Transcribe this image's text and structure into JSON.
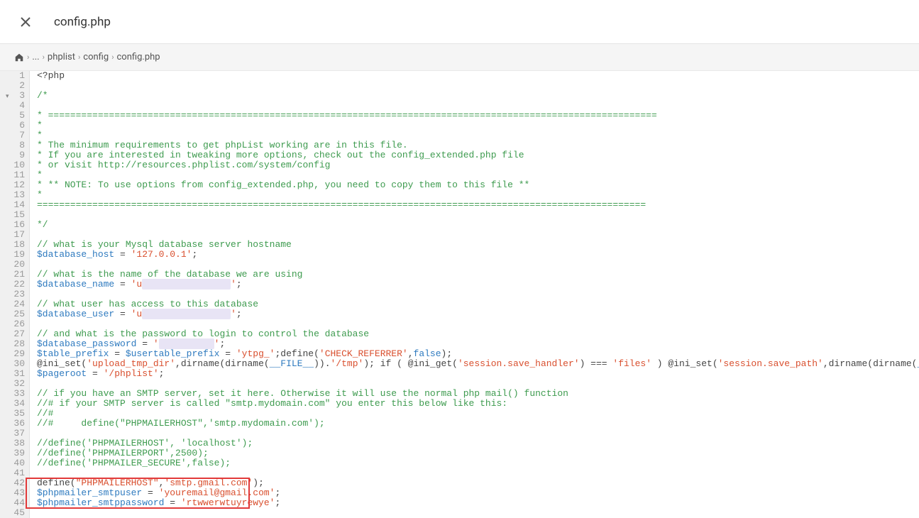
{
  "header": {
    "title": "config.php"
  },
  "breadcrumb": {
    "ellipsis": "...",
    "items": [
      "phplist",
      "config",
      "config.php"
    ]
  },
  "code": {
    "startLine": 1,
    "foldLines": [
      3
    ],
    "lines": [
      {
        "n": 1,
        "segs": [
          [
            "<?php",
            "default"
          ]
        ]
      },
      {
        "n": 2,
        "segs": [
          [
            "",
            "default"
          ]
        ]
      },
      {
        "n": 3,
        "segs": [
          [
            "/*",
            "comment"
          ]
        ]
      },
      {
        "n": 4,
        "segs": [
          [
            "",
            "default"
          ]
        ]
      },
      {
        "n": 5,
        "segs": [
          [
            "* ==============================================================================================================",
            "comment"
          ]
        ]
      },
      {
        "n": 6,
        "segs": [
          [
            "*",
            "comment"
          ]
        ]
      },
      {
        "n": 7,
        "segs": [
          [
            "*",
            "comment"
          ]
        ]
      },
      {
        "n": 8,
        "segs": [
          [
            "* The minimum requirements to get phpList working are in this file.",
            "comment"
          ]
        ]
      },
      {
        "n": 9,
        "segs": [
          [
            "* If you are interested in tweaking more options, check out the config_extended.php file",
            "comment"
          ]
        ]
      },
      {
        "n": 10,
        "segs": [
          [
            "* or visit http://resources.phplist.com/system/config",
            "comment"
          ]
        ]
      },
      {
        "n": 11,
        "segs": [
          [
            "*",
            "comment"
          ]
        ]
      },
      {
        "n": 12,
        "segs": [
          [
            "* ** NOTE: To use options from config_extended.php, you need to copy them to this file **",
            "comment"
          ]
        ]
      },
      {
        "n": 13,
        "segs": [
          [
            "*",
            "comment"
          ]
        ]
      },
      {
        "n": 14,
        "segs": [
          [
            "==============================================================================================================",
            "comment"
          ]
        ]
      },
      {
        "n": 15,
        "segs": [
          [
            "",
            "default"
          ]
        ]
      },
      {
        "n": 16,
        "segs": [
          [
            "*/",
            "comment"
          ]
        ]
      },
      {
        "n": 17,
        "segs": [
          [
            "",
            "default"
          ]
        ]
      },
      {
        "n": 18,
        "segs": [
          [
            "// what is your Mysql database server hostname",
            "comment"
          ]
        ]
      },
      {
        "n": 19,
        "segs": [
          [
            "$database_host",
            "var"
          ],
          [
            " = ",
            "default"
          ],
          [
            "'127.0.0.1'",
            "string"
          ],
          [
            ";",
            "default"
          ]
        ]
      },
      {
        "n": 20,
        "segs": [
          [
            "",
            "default"
          ]
        ]
      },
      {
        "n": 21,
        "segs": [
          [
            "// what is the name of the database we are using",
            "comment"
          ]
        ]
      },
      {
        "n": 22,
        "segs": [
          [
            "$database_name",
            "var"
          ],
          [
            " = ",
            "default"
          ],
          [
            "'u",
            "string"
          ],
          [
            "                ",
            "redacted"
          ],
          [
            "'",
            "string"
          ],
          [
            ";",
            "default"
          ]
        ]
      },
      {
        "n": 23,
        "segs": [
          [
            "",
            "default"
          ]
        ]
      },
      {
        "n": 24,
        "segs": [
          [
            "// what user has access to this database",
            "comment"
          ]
        ]
      },
      {
        "n": 25,
        "segs": [
          [
            "$database_user",
            "var"
          ],
          [
            " = ",
            "default"
          ],
          [
            "'u",
            "string"
          ],
          [
            "                ",
            "redacted"
          ],
          [
            "'",
            "string"
          ],
          [
            ";",
            "default"
          ]
        ]
      },
      {
        "n": 26,
        "segs": [
          [
            "",
            "default"
          ]
        ]
      },
      {
        "n": 27,
        "segs": [
          [
            "// and what is the password to login to control the database",
            "comment"
          ]
        ]
      },
      {
        "n": 28,
        "segs": [
          [
            "$database_password",
            "var"
          ],
          [
            " = ",
            "default"
          ],
          [
            "'",
            "string"
          ],
          [
            "          ",
            "redacted"
          ],
          [
            "'",
            "string"
          ],
          [
            ";",
            "default"
          ]
        ]
      },
      {
        "n": 29,
        "segs": [
          [
            "$table_prefix",
            "var"
          ],
          [
            " = ",
            "default"
          ],
          [
            "$usertable_prefix",
            "var"
          ],
          [
            " = ",
            "default"
          ],
          [
            "'ytpg_'",
            "string"
          ],
          [
            ";define(",
            "default"
          ],
          [
            "'CHECK_REFERRER'",
            "string"
          ],
          [
            ",",
            "default"
          ],
          [
            "false",
            "const"
          ],
          [
            ");",
            "default"
          ]
        ]
      },
      {
        "n": 30,
        "segs": [
          [
            "@ini_set(",
            "default"
          ],
          [
            "'upload_tmp_dir'",
            "string"
          ],
          [
            ",dirname(dirname(",
            "default"
          ],
          [
            "__FILE__",
            "const"
          ],
          [
            ")).",
            "default"
          ],
          [
            "'/tmp'",
            "string"
          ],
          [
            "); if ( @ini_get(",
            "default"
          ],
          [
            "'session.save_handler'",
            "string"
          ],
          [
            ") === ",
            "default"
          ],
          [
            "'files'",
            "string"
          ],
          [
            " ) @ini_set(",
            "default"
          ],
          [
            "'session.save_path'",
            "string"
          ],
          [
            ",dirname(dirname(",
            "default"
          ],
          [
            "__FILE__",
            "const"
          ],
          [
            ")).",
            "default"
          ],
          [
            "'/tmp'",
            "string"
          ],
          [
            ");",
            "default"
          ]
        ]
      },
      {
        "n": 31,
        "segs": [
          [
            "$pageroot",
            "var"
          ],
          [
            " = ",
            "default"
          ],
          [
            "'/phplist'",
            "string"
          ],
          [
            ";",
            "default"
          ]
        ]
      },
      {
        "n": 32,
        "segs": [
          [
            "",
            "default"
          ]
        ]
      },
      {
        "n": 33,
        "segs": [
          [
            "// if you have an SMTP server, set it here. Otherwise it will use the normal php mail() function",
            "comment"
          ]
        ]
      },
      {
        "n": 34,
        "segs": [
          [
            "//# if your SMTP server is called \"smtp.mydomain.com\" you enter this below like this:",
            "comment"
          ]
        ]
      },
      {
        "n": 35,
        "segs": [
          [
            "//#",
            "comment"
          ]
        ]
      },
      {
        "n": 36,
        "segs": [
          [
            "//#     define(\"PHPMAILERHOST\",'smtp.mydomain.com');",
            "comment"
          ]
        ]
      },
      {
        "n": 37,
        "segs": [
          [
            "",
            "default"
          ]
        ]
      },
      {
        "n": 38,
        "segs": [
          [
            "//define('PHPMAILERHOST', 'localhost');",
            "comment"
          ]
        ]
      },
      {
        "n": 39,
        "segs": [
          [
            "//define('PHPMAILERPORT',2500);",
            "comment"
          ]
        ]
      },
      {
        "n": 40,
        "segs": [
          [
            "//define('PHPMAILER_SECURE',false);",
            "comment"
          ]
        ]
      },
      {
        "n": 41,
        "segs": [
          [
            "",
            "default"
          ]
        ]
      },
      {
        "n": 42,
        "segs": [
          [
            "define(",
            "default"
          ],
          [
            "\"PHPMAILERHOST\"",
            "string"
          ],
          [
            ",",
            "default"
          ],
          [
            "'smtp.gmail.com'",
            "string"
          ],
          [
            ");",
            "default"
          ]
        ]
      },
      {
        "n": 43,
        "segs": [
          [
            "$phpmailer_smtpuser",
            "var"
          ],
          [
            " = ",
            "default"
          ],
          [
            "'youremail@gmail.com'",
            "string"
          ],
          [
            ";",
            "default"
          ]
        ]
      },
      {
        "n": 44,
        "segs": [
          [
            "$phpmailer_smtppassword",
            "var"
          ],
          [
            " = ",
            "default"
          ],
          [
            "'rtwwerwtuyrewye'",
            "string"
          ],
          [
            ";",
            "default"
          ]
        ]
      },
      {
        "n": 45,
        "segs": [
          [
            "",
            "default"
          ]
        ]
      }
    ],
    "highlightBox": {
      "startLine": 42,
      "endLine": 44
    }
  }
}
